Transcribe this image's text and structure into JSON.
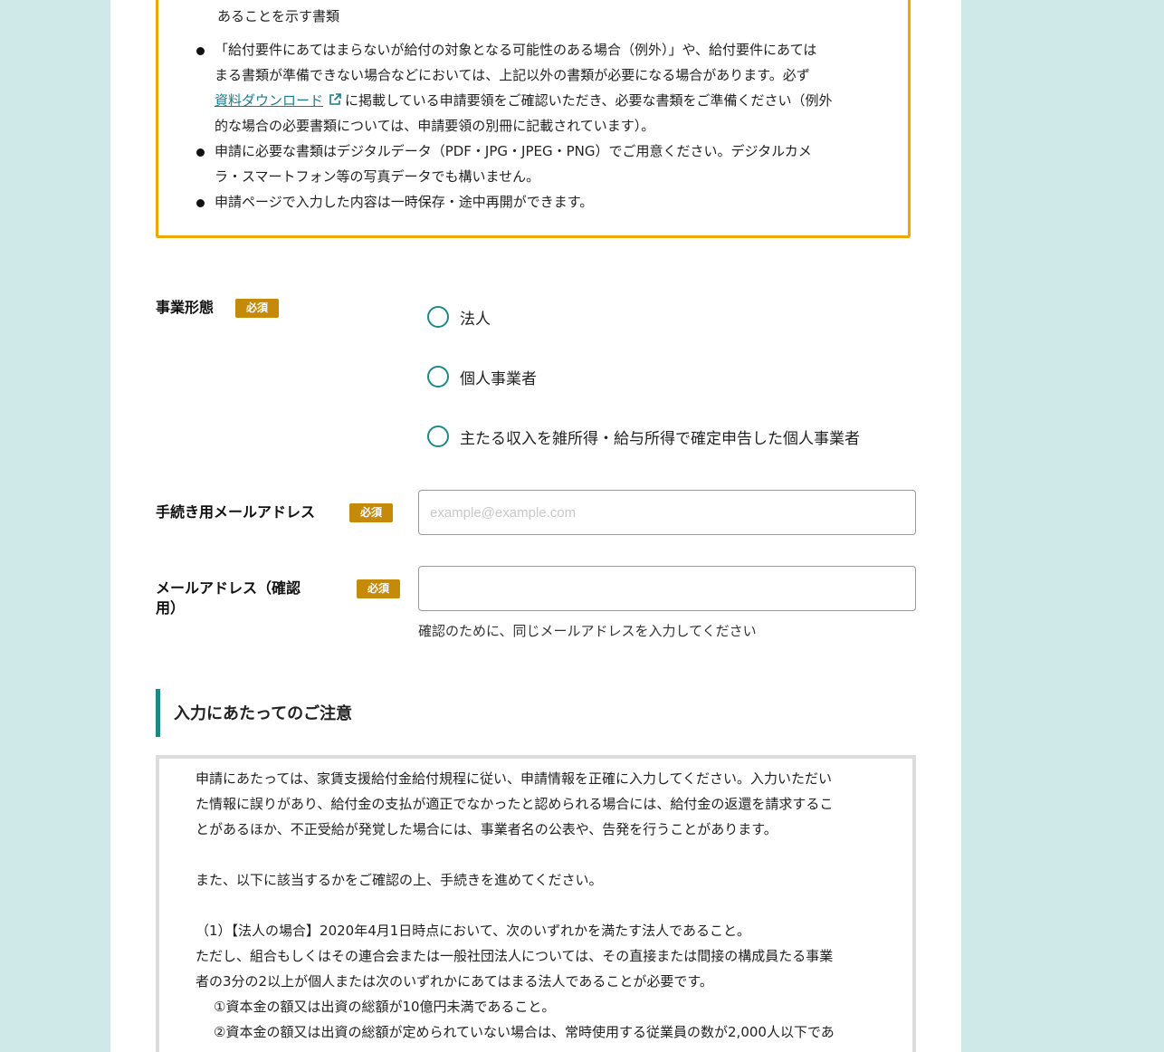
{
  "notice": {
    "top_partial": "あることを示す書類",
    "bullets": [
      {
        "lines": [
          "「給付要件にあてはまらないが給付の対象となる可能性のある場合（例外）」や、給付要件にあては",
          "まる書類が準備できない場合などにおいては、上記以外の書類が必要になる場合があります。必ず"
        ],
        "link_text": "資料ダウンロード",
        "link_after": "に掲載している申請要領をご確認いただき、必要な書類をご準備ください（例外",
        "last_line": "的な場合の必要書類については、申請要領の別冊に記載されています）。"
      },
      {
        "lines": [
          "申請に必要な書類はデジタルデータ（PDF・JPG・JPEG・PNG）でご用意ください。デジタルカメ",
          "ラ・スマートフォン等の写真データでも構いません。"
        ]
      },
      {
        "lines": [
          "申請ページで入力した内容は一時保存・途中再開ができます。"
        ]
      }
    ]
  },
  "form": {
    "required_label": "必須",
    "business_type": {
      "label": "事業形態",
      "options": [
        "法人",
        "個人事業者",
        "主たる収入を雑所得・給与所得で確定申告した個人事業者"
      ]
    },
    "email": {
      "label": "手続き用メールアドレス",
      "placeholder": "example@example.com",
      "value": ""
    },
    "email_confirm": {
      "label_line1": "メールアドレス（確認",
      "label_line2": "用）",
      "value": "",
      "hint": "確認のために、同じメールアドレスを入力してください"
    }
  },
  "caution": {
    "title": "入力にあたってのご注意",
    "lines": [
      "申請にあたっては、家賃支援給付金給付規程に従い、申請情報を正確に入力してください。入力いただい",
      "た情報に誤りがあり、給付金の支払が適正でなかったと認められる場合には、給付金の返還を請求するこ",
      "とがあるほか、不正受給が発覚した場合には、事業者名の公表や、告発を行うことがあります。",
      "",
      "また、以下に該当するかをご確認の上、手続きを進めてください。",
      "",
      "（1）【法人の場合】2020年4月1日時点において、次のいずれかを満たす法人であること。",
      "ただし、組合もしくはその連合会または一般社団法人については、その直接または間接の構成員たる事業",
      "者の3分の2以上が個人または次のいずれかにあてはまる法人であることが必要です。",
      "①資本金の額又は出資の総額が10億円未満であること。",
      "②資本金の額又は出資の総額が定められていない場合は、常時使用する従業員の数が2,000人以下であ"
    ]
  }
}
